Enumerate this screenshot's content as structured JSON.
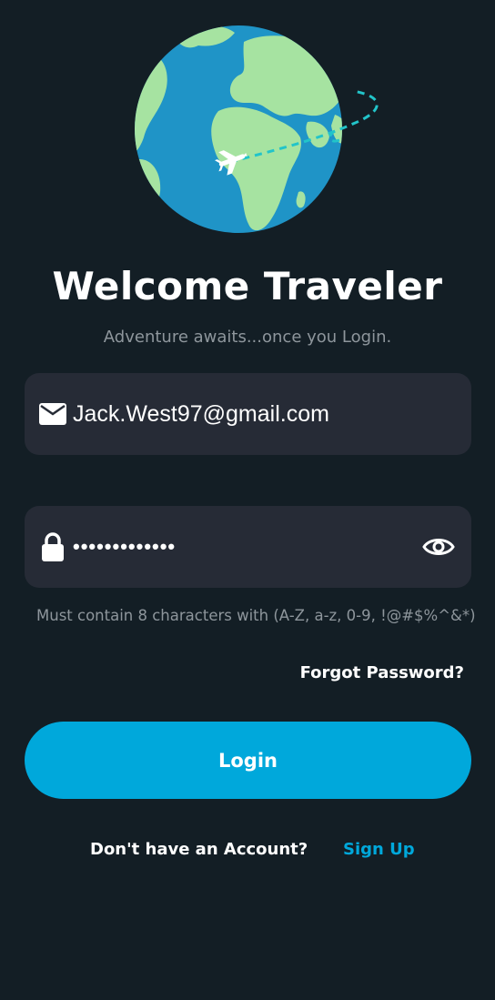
{
  "header": {
    "title": "Welcome Traveler",
    "subtitle": "Adventure awaits...once you Login."
  },
  "illustration": {
    "icon": "globe-with-airplane-icon"
  },
  "form": {
    "email": {
      "icon": "mail-icon",
      "value": "Jack.West97@gmail.com"
    },
    "password": {
      "icon": "lock-icon",
      "value": "•••••••••••••",
      "toggle_icon": "eye-icon"
    },
    "password_hint": "Must contain 8 characters with (A-Z, a-z, 0-9, !@#$%^&*)",
    "forgot_label": "Forgot Password?",
    "login_label": "Login"
  },
  "footer": {
    "prompt": "Don't have an Account?",
    "signup_label": "Sign Up"
  },
  "colors": {
    "background": "#131e25",
    "field": "#262b36",
    "accent": "#00a8db",
    "ocean": "#1f94c7",
    "land": "#a6e3a1"
  }
}
